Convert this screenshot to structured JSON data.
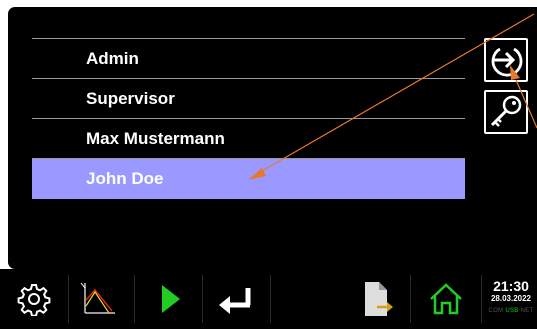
{
  "users": [
    {
      "name": "Admin",
      "selected": false
    },
    {
      "name": "Supervisor",
      "selected": false
    },
    {
      "name": "Max Mustermann",
      "selected": false
    },
    {
      "name": "John Doe",
      "selected": true
    }
  ],
  "side_buttons": {
    "login_icon": "login-icon",
    "key_icon": "key-icon"
  },
  "toolbar": {
    "icons": [
      "gear-icon",
      "chart-icon",
      "play-icon",
      "enter-icon",
      "export-file-icon",
      "home-icon"
    ],
    "time": "21:30",
    "date": "28.03.2022",
    "status_com": "COM",
    "status_usb": "USB",
    "status_net": "NET"
  },
  "colors": {
    "selected_row": "#9999ff",
    "play": "#22cc22",
    "home": "#22cc22",
    "annotation_arrow": "#e8782a"
  }
}
